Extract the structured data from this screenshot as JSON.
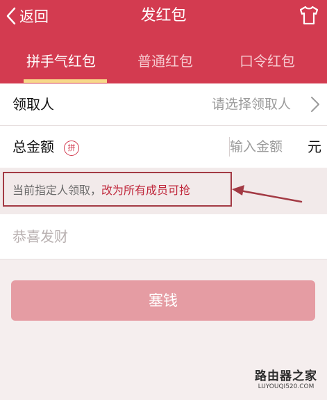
{
  "topbar": {
    "back_label": "返回",
    "title": "发红包"
  },
  "tabs": [
    {
      "label": "拼手气红包",
      "active": true
    },
    {
      "label": "普通红包",
      "active": false
    },
    {
      "label": "口令红包",
      "active": false
    }
  ],
  "recipient": {
    "label": "领取人",
    "placeholder": "请选择领取人"
  },
  "amount": {
    "label": "总金额",
    "badge": "拼",
    "placeholder": "输入金额",
    "unit": "元"
  },
  "notice": {
    "text": "当前指定人领取，",
    "link": "改为所有成员可抢"
  },
  "greeting": {
    "placeholder": "恭喜发财"
  },
  "submit_label": "塞钱",
  "watermark": {
    "text": "路由器之家",
    "url": "LUYOUQI520.COM"
  },
  "colors": {
    "brand_red": "#d33b50",
    "submit_pink": "#e59ca3",
    "tab_underline": "#f7d98a",
    "annotation": "#a33a44"
  },
  "icons": [
    "back-chevron-icon",
    "tshirt-icon",
    "chevron-right-icon",
    "arrow-annotation-icon"
  ]
}
